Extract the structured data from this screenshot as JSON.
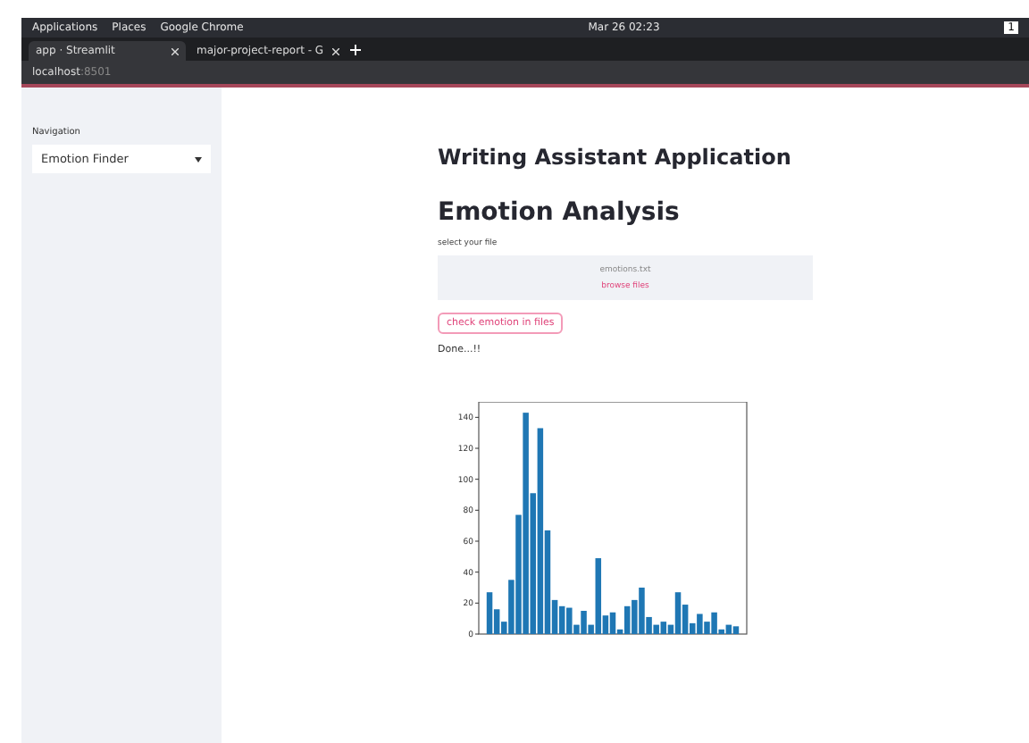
{
  "os_bar": {
    "menu": [
      "Applications",
      "Places",
      "Google Chrome"
    ],
    "clock": "Mar 26  02:23",
    "workspace": "1"
  },
  "tabs": [
    {
      "label": "app · Streamlit",
      "selected": true
    },
    {
      "label": "major-project-report - G",
      "selected": false
    }
  ],
  "address": {
    "host": "localhost",
    "port": ":8501"
  },
  "sidebar": {
    "label": "Navigation",
    "select": "Emotion Finder"
  },
  "main": {
    "title": "Writing Assistant Application",
    "heading": "Emotion Analysis",
    "upload_label": "select your file",
    "file_name": "emotions.txt",
    "browse": "browse files",
    "button": "check emotion in files",
    "status": "Done...!!",
    "chart_data": {
      "type": "bar",
      "yticks": [
        0,
        20,
        40,
        60,
        80,
        100,
        120,
        140
      ],
      "ylim": [
        0,
        150
      ],
      "series": [
        {
          "color": "#1f77b4",
          "values": [
            27,
            16,
            8,
            35,
            77,
            143,
            91,
            133,
            67,
            22,
            18,
            17,
            6,
            15,
            6,
            49,
            12,
            14,
            3,
            18,
            22,
            30,
            11,
            6,
            8,
            6,
            27,
            19,
            7,
            13,
            8,
            14,
            3,
            6,
            5
          ]
        }
      ]
    }
  }
}
